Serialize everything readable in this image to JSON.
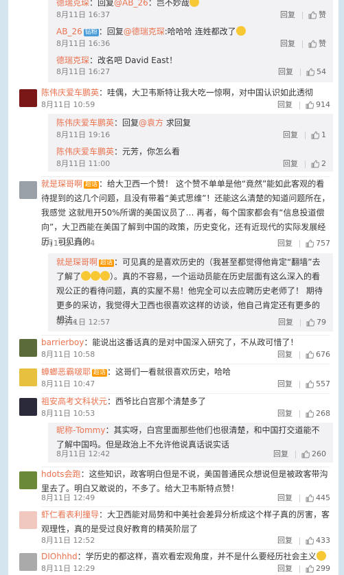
{
  "actions": {
    "reply": "回复",
    "like": "赞"
  },
  "comments": [
    {
      "name": "德瑞克琛",
      "text_prefix": "：回复",
      "mention": "@AB_26",
      "text": "：岂不妙哉",
      "time": "8月11日 16:37",
      "likes": ""
    },
    {
      "name": "AB_26",
      "badge": "钻粉",
      "text_prefix": "：回复",
      "mention": "@德瑞克琛",
      "text": ":哈哈哈 连姓都改了",
      "time": "8月11日 16:36",
      "likes": ""
    },
    {
      "name": "德瑞克琛",
      "text": "：改名吧 David East！",
      "time": "8月11日 16:27",
      "likes": "54"
    },
    {
      "name": "陈伟庆爱车鹏英",
      "text": "：哇偶，大卫韦斯特让我大吃一惊啊，对中国认识如此透彻",
      "time": "8月11日 10:59",
      "likes": "914"
    },
    {
      "name": "陈伟庆爱车鹏英",
      "text_prefix": "：回复",
      "mention": "@袁方",
      "text": " 求回复",
      "time": "8月11日 19:16",
      "likes": "1"
    },
    {
      "name": "陈伟庆爱车鹏英",
      "text": "：元芳，你怎么看",
      "time": "8月11日 11:00",
      "likes": "2"
    },
    {
      "name": "就是琛哥啊",
      "badge": "超话",
      "text": "：给大卫西一个赞！ 这个赞不单单是他“竟然”能如此客观的看待提到的这几个问题，且没有带着“美式思维”！还能这么清楚的知道问题所在，我感觉 这就甩开50%所谓的美国议员了… 再者，每个国家都会有“信息投道偿向”，大卫西能在美国了解到中国的政策，历史变化，还有近现代的实际发展经历，可见真的",
      "time": "8月11日 12:54",
      "likes": "757"
    },
    {
      "name": "就是琛哥啊",
      "badge": "超话",
      "text": "：可见真的是喜欢历史的（我甚至都觉得他肯定“翻墙”去了解了",
      "text2": "）。真的不容易，一个运动员能在历史层面有这么深入的看观公正的看待问题，真的实屋不易！他完全可以去应聘历史老师了！ 期待更多的采访，我觉得大卫西也很喜欢这样的访谈，他自己肯定还有更多的想法。",
      "time": "8月11日 12:57",
      "likes": "79"
    },
    {
      "name": "barrierboy",
      "text": "：能说出这番话真的是对中国深入研究了，不从政可惜了！",
      "time": "8月11日 10:58",
      "likes": "676"
    },
    {
      "name": "蟑螂恶霸啵耶",
      "badge": "超话",
      "text": "：这哥们一看就很喜欢历史，哈哈",
      "time": "8月11日 10:47",
      "likes": "557"
    },
    {
      "name": "祖安高考文科状元",
      "text": "：西爷比白宫那个清楚多了",
      "time": "8月11日 10:53",
      "likes": "268"
    },
    {
      "name": "昵称-Tommy",
      "text": "：其实呀，白宫里面那些他们也很清楚，和中国打交道能不了解中国吗。但是政治上不允许他说真话说实话",
      "time": "8月11日 12:42",
      "likes": "260"
    },
    {
      "name": "hdots会跑",
      "text": "：这些知识，政客明白但是不说，美国普通民众想说但是被政客带沟里去了。明白又敢说的，不多了。给大卫韦斯特点赞！",
      "time": "8月11日 12:49",
      "likes": "445"
    },
    {
      "name": "虾仁看表利撞导",
      "text": "：大卫西能对局势和中美社会差异分析成这个样子真的厉害，客观理性，真的是受过良好教育的精英阶层了",
      "time": "8月11日 12:52",
      "likes": "433"
    },
    {
      "name": "DIOhhhd",
      "text": "：学历史的都这样，喜欢看宏观角度，并不是什么要经历社会主义",
      "time": "8月11日 12:29",
      "likes": "299"
    }
  ]
}
